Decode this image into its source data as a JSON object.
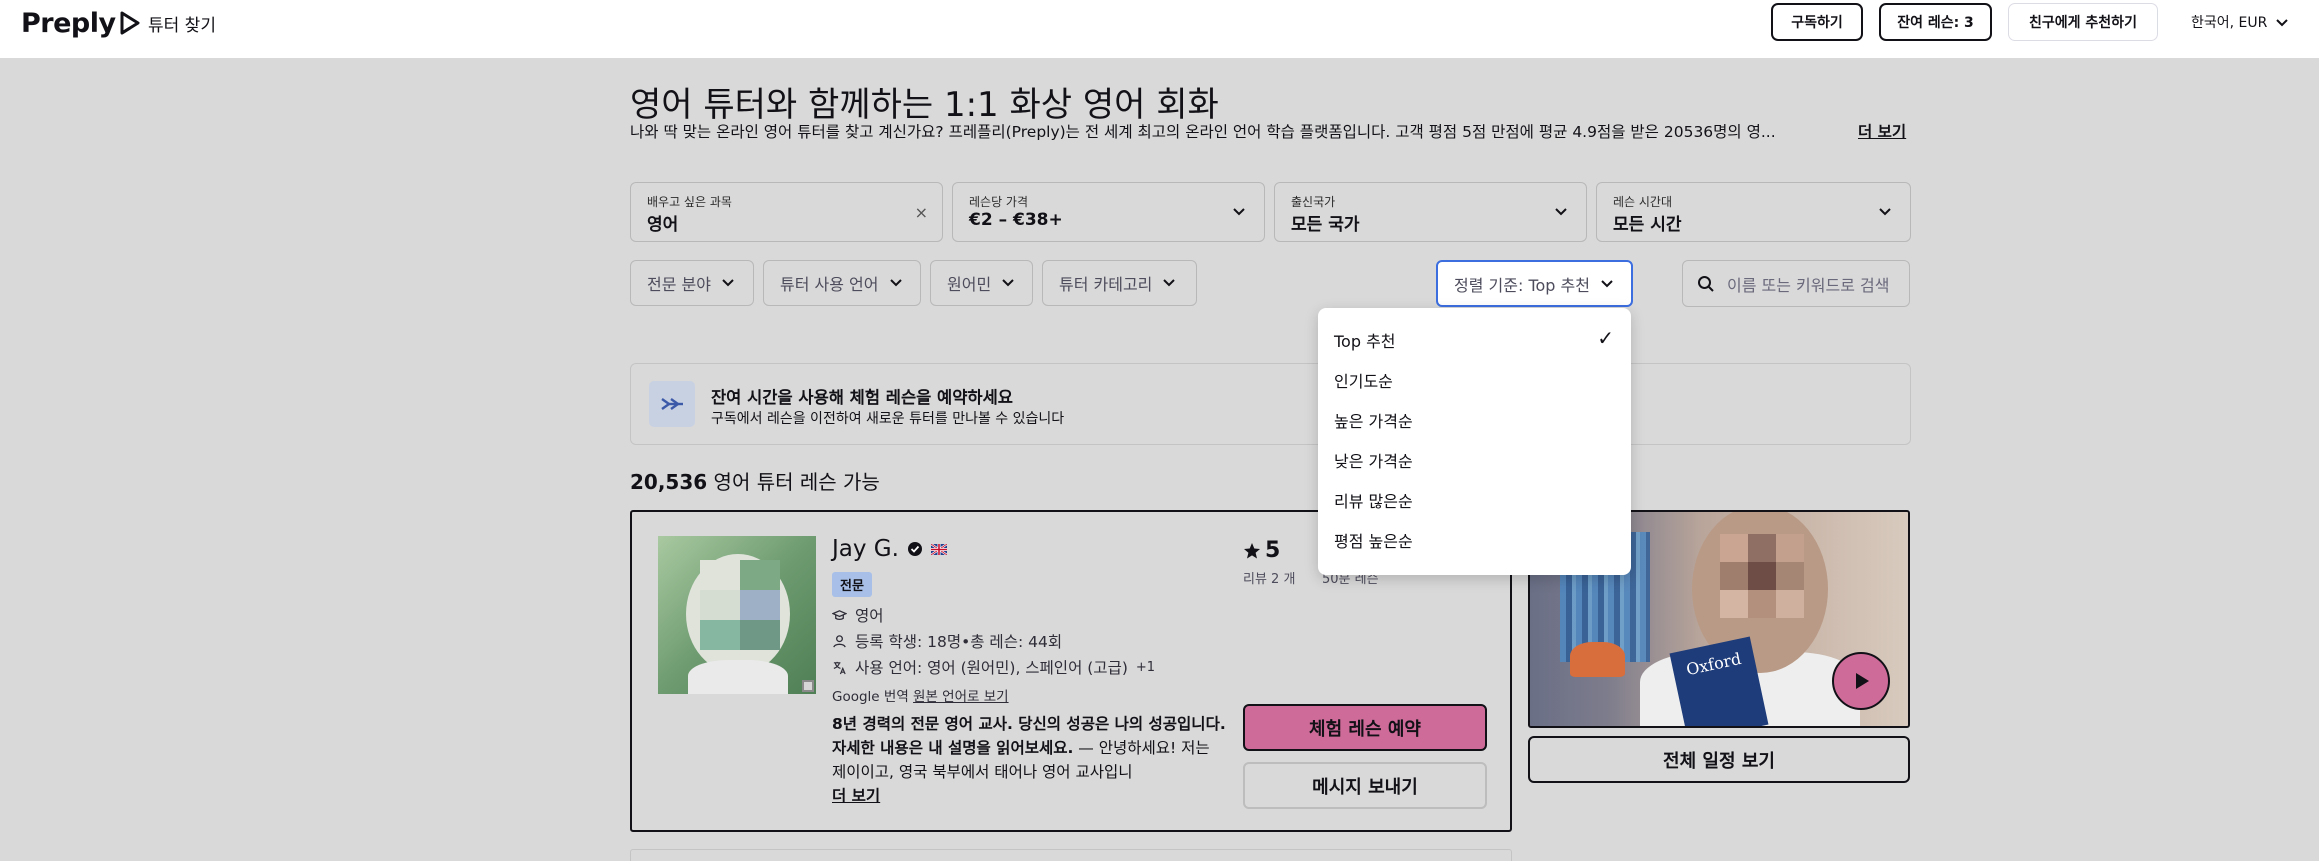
{
  "header": {
    "logo_text": "Preply",
    "nav_find": "튜터 찾기",
    "subscribe": "구독하기",
    "remaining": "잔여 레슨: 3",
    "refer": "친구에게 추천하기",
    "language": "한국어, EUR"
  },
  "main": {
    "title": "영어 튜터와 함께하는 1:1 화상 영어 회화",
    "description": "나와 딱 맞는 온라인 영어 튜터를 찾고 계신가요? 프레플리(Preply)는 전 세계 최고의 온라인 언어 학습 플랫폼입니다. 고객 평점 5점 만점에 평균 4.9점을 받은 20536명의 영...",
    "more": "더 보기"
  },
  "filters": {
    "subject": {
      "label": "배우고 싶은 과목",
      "value": "영어",
      "clear": "×"
    },
    "price": {
      "label": "레슨당 가격",
      "value": "€2 – €38+"
    },
    "country": {
      "label": "출신국가",
      "value": "모든 국가"
    },
    "time": {
      "label": "레슨 시간대",
      "value": "모든 시간"
    },
    "specialty": "전문 분야",
    "tutor_lang": "튜터 사용 언어",
    "native": "원어민",
    "category": "튜터 카테고리",
    "sort": "정렬 기준: Top 추천",
    "search_placeholder": "이름 또는 키워드로 검색"
  },
  "sort_menu": {
    "options": [
      "Top 추천",
      "인기도순",
      "높은 가격순",
      "낮은 가격순",
      "리뷰 많은순",
      "평점 높은순"
    ],
    "selected_mark": "✓"
  },
  "banner": {
    "title": "잔여 시간을 사용해 체험 레슨을 예약하세요",
    "subtitle": "구독에서 레슨을 이전하여 새로운 튜터를 만나볼 수 있습니다"
  },
  "results": {
    "count": "20,536",
    "label": "영어 튜터 레슨 가능"
  },
  "tutor": {
    "name": "Jay G.",
    "badge": "전문",
    "subject": "영어",
    "students": "등록 학생: 18명•총 레슨: 44회",
    "languages": "사용 언어: 영어 (원어민), 스페인어 (고급)",
    "languages_more": "+1",
    "google_translate": "Google 번역",
    "original": "원본 언어로 보기",
    "desc_bold": "8년 경력의 전문 영어 교사. 당신의 성공은 나의 성공입니다. 자세한 내용은 내 설명을 읽어보세요.",
    "desc_rest": " — 안녕하세요! 저는 제이이고, 영국 북부에서 태어나 영어 교사입니",
    "desc_more": "더 보기",
    "rating": "5",
    "reviews": "리뷰 2 개",
    "lesson_len": "50분 레슨",
    "trial_button": "체험 레슨 예약",
    "message_button": "메시지 보내기",
    "schedule_button": "전체 일정 보기",
    "book_text": "Oxford"
  }
}
